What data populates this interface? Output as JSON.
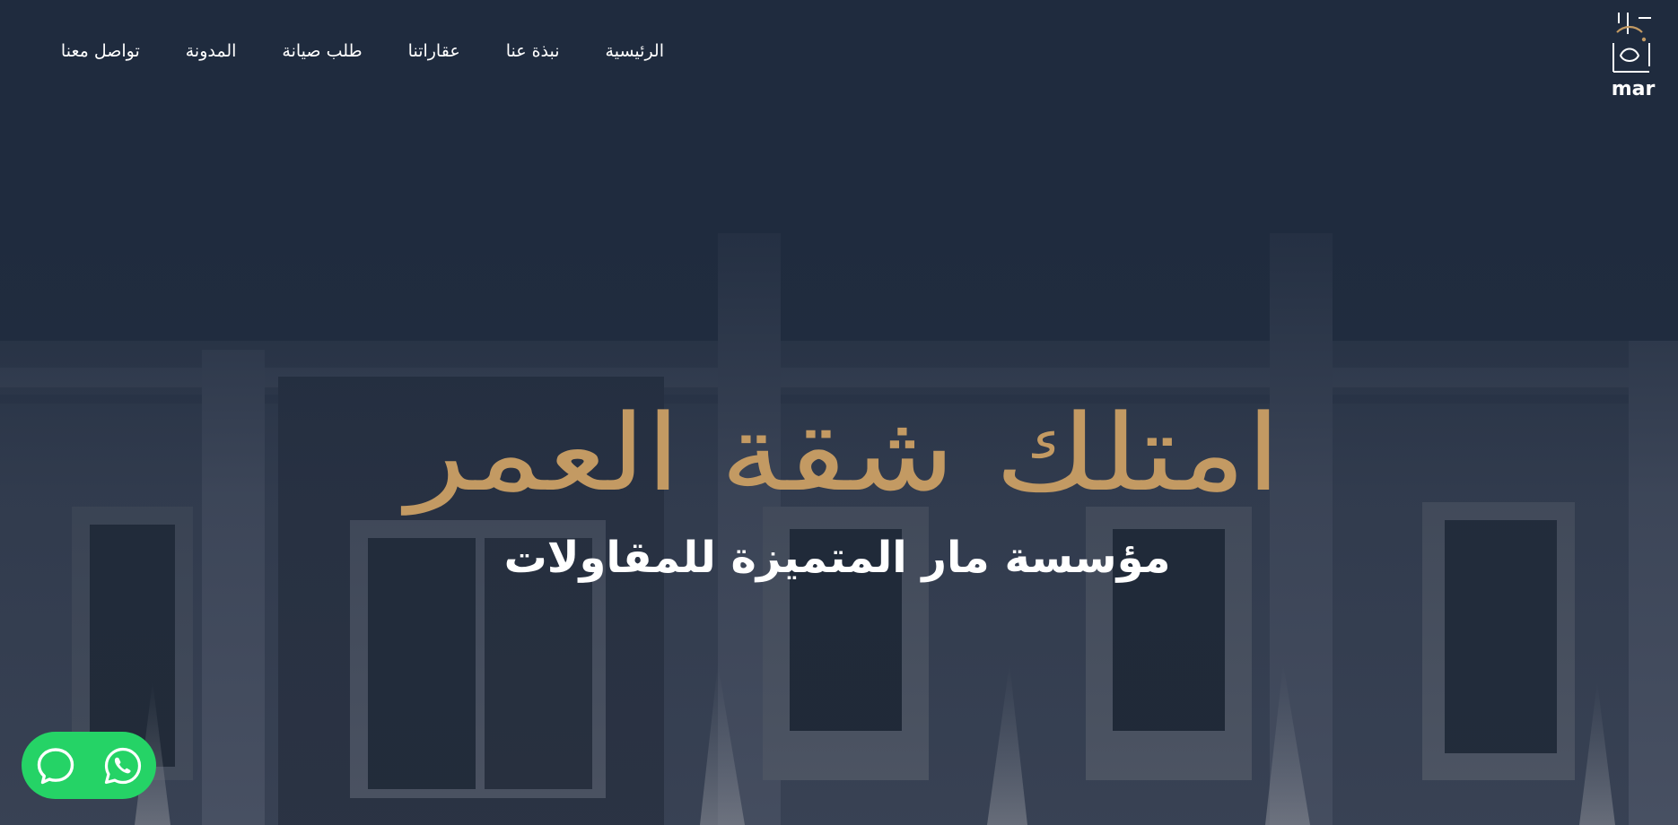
{
  "brand": {
    "logo_text": "mar",
    "logo_icon": "mar-logo-icon"
  },
  "nav": {
    "items": [
      {
        "label": "الرئيسية"
      },
      {
        "label": "نبذة عنا"
      },
      {
        "label": "عقاراتنا"
      },
      {
        "label": "طلب صيانة"
      },
      {
        "label": "المدونة"
      },
      {
        "label": "تواصل معنا"
      }
    ]
  },
  "hero": {
    "title": "امتلك شقة العمر",
    "subtitle": "مؤسسة مار المتميزة للمقاولات"
  },
  "floating": {
    "chat_icon": "chat-bubble-icon",
    "whatsapp_icon": "whatsapp-icon"
  },
  "colors": {
    "background": "#1f2b3d",
    "accent_gold": "#c39a63",
    "whatsapp_green": "#25d366",
    "text": "#ffffff"
  }
}
